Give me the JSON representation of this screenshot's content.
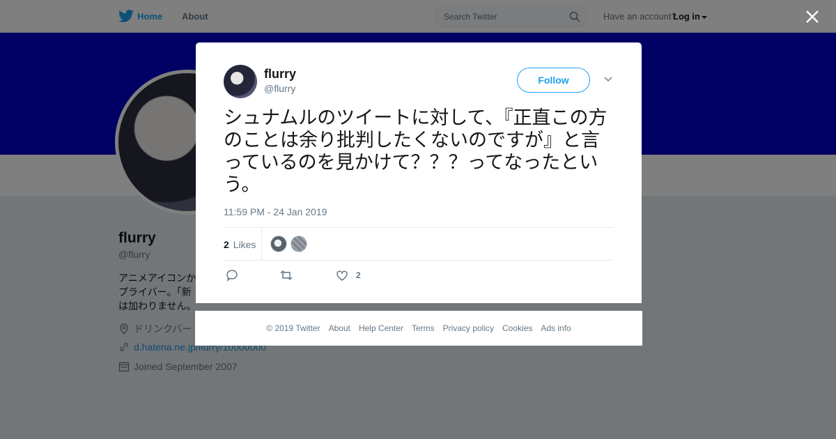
{
  "topbar": {
    "home": "Home",
    "about": "About",
    "search_placeholder": "Search Twitter",
    "have_account": "Have an account?",
    "login": "Log in"
  },
  "profile": {
    "name": "flurry",
    "handle": "@flurry",
    "bio_lines": [
      "アニメアイコンか",
      "プライバー。「新",
      "は加わりません。"
    ],
    "location": "ドリンクバー",
    "link": "d.hatena.ne.jp/flurry/10000000",
    "joined": "Joined September 2007",
    "banner_color": "#0000c8"
  },
  "tweet": {
    "name": "flurry",
    "handle": "@flurry",
    "follow_label": "Follow",
    "text": "シュナムルのツイートに対して、『正直この方のことは余り批判したくないのですが』と言っているのを見かけて？？？ってなったという。",
    "timestamp": "11:59 PM - 24 Jan 2019",
    "likes_count": "2",
    "likes_label": "Likes",
    "like_action_count": "2"
  },
  "footer": {
    "links": [
      "© 2019 Twitter",
      "About",
      "Help Center",
      "Terms",
      "Privacy policy",
      "Cookies",
      "Ads info"
    ]
  },
  "icons": {
    "brand": "twitter-bird-icon",
    "search": "search-icon",
    "close": "close-icon",
    "chevron": "chevron-down-icon",
    "reply": "reply-icon",
    "retweet": "retweet-icon",
    "like": "heart-icon",
    "location": "location-icon",
    "link": "link-icon",
    "calendar": "calendar-icon"
  },
  "colors": {
    "accent": "#1da1f2",
    "overlay": "rgba(0,0,0,0.5)"
  }
}
